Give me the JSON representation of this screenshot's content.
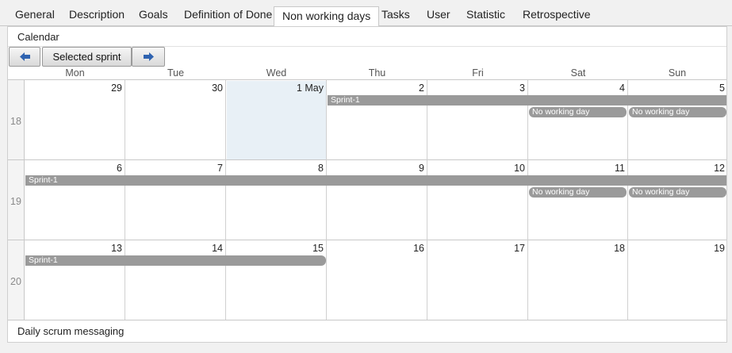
{
  "tabs": [
    {
      "label": "General"
    },
    {
      "label": "Description"
    },
    {
      "label": "Goals"
    },
    {
      "label": "Definition of Done"
    },
    {
      "label": "Non working days",
      "active": true
    },
    {
      "label": "Tasks"
    },
    {
      "label": "User"
    },
    {
      "label": "Statistic"
    },
    {
      "label": "Retrospective"
    }
  ],
  "panel": {
    "title": "Calendar",
    "prev_icon": "arrow-left-icon",
    "selected_sprint_label": "Selected sprint",
    "next_icon": "arrow-right-icon",
    "footer_label": "Daily scrum messaging"
  },
  "calendar": {
    "day_headers": [
      "Mon",
      "Tue",
      "Wed",
      "Thu",
      "Fri",
      "Sat",
      "Sun"
    ],
    "weeks": [
      {
        "week": "18",
        "days": [
          "29",
          "30",
          "1 May",
          "2",
          "3",
          "4",
          "5"
        ]
      },
      {
        "week": "19",
        "days": [
          "6",
          "7",
          "8",
          "9",
          "10",
          "11",
          "12"
        ]
      },
      {
        "week": "20",
        "days": [
          "13",
          "14",
          "15",
          "16",
          "17",
          "18",
          "19"
        ]
      }
    ],
    "today_cell": "1 May",
    "events": {
      "sprint_label": "Sprint-1",
      "non_working_label": "No working day"
    }
  },
  "colors": {
    "event_bar": "#9a9a9a",
    "today_highlight": "#e8f0f6",
    "arrow_blue": "#2f63b0"
  }
}
